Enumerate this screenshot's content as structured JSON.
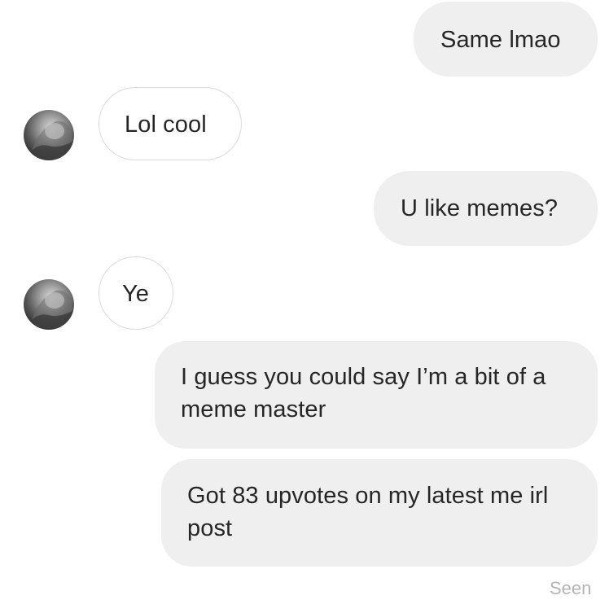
{
  "conversation": {
    "messages": [
      {
        "direction": "outgoing",
        "text": "Same lmao"
      },
      {
        "direction": "incoming",
        "text": "Lol cool"
      },
      {
        "direction": "outgoing",
        "text": "U like memes?"
      },
      {
        "direction": "incoming",
        "text": "Ye"
      },
      {
        "direction": "outgoing",
        "text": "I guess you could say I’m a bit of a meme master"
      },
      {
        "direction": "outgoing",
        "text": "Got 83 upvotes on my latest me irl post"
      }
    ],
    "status": "Seen"
  },
  "colors": {
    "outgoing_bubble": "#efefef",
    "incoming_bubble": "#ffffff",
    "incoming_border": "#dbdbdb",
    "text": "#262626",
    "status_text": "#b4b4b4"
  },
  "icons": {
    "contact_avatar": "avatar"
  }
}
